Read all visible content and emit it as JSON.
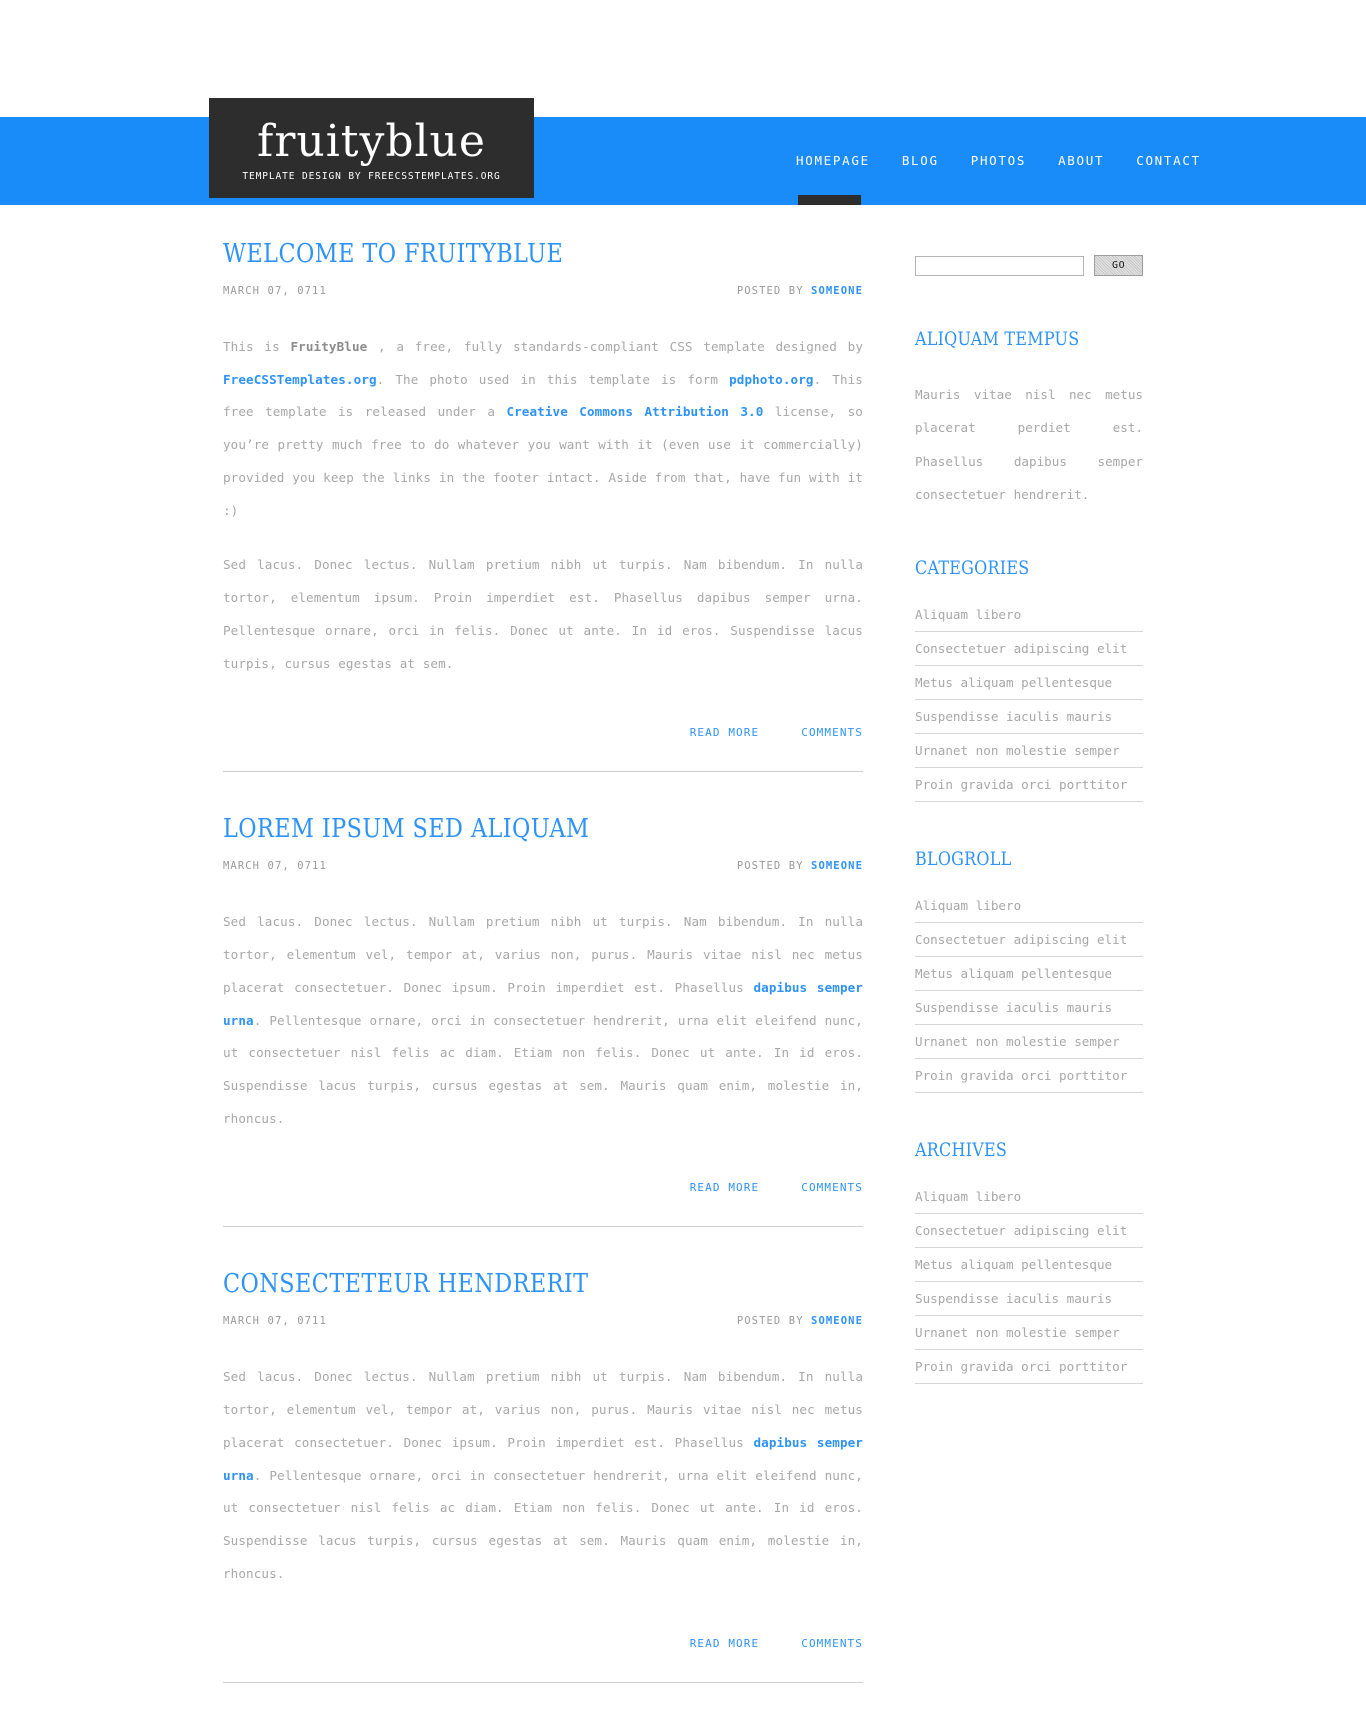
{
  "site": {
    "logo_title": "fruityblue",
    "logo_subtitle": "TEMPLATE DESIGN BY FREECSSTEMPLATES.ORG",
    "accent_blue": "#1a8cfa",
    "link_blue": "#2e93f7",
    "dark": "#2d2d2d"
  },
  "nav": {
    "items": [
      {
        "label": "HOMEPAGE",
        "active": true
      },
      {
        "label": "BLOG",
        "active": false
      },
      {
        "label": "PHOTOS",
        "active": false
      },
      {
        "label": "ABOUT",
        "active": false
      },
      {
        "label": "CONTACT",
        "active": false
      }
    ]
  },
  "posts": [
    {
      "title": "WELCOME TO FRUITYBLUE",
      "date": "MARCH 07, 0711",
      "posted_by_label": "POSTED BY",
      "author": "SOMEONE",
      "paragraph1_parts": [
        {
          "text": "This is ",
          "style": "normal"
        },
        {
          "text": "FruityBlue",
          "style": "bold"
        },
        {
          "text": " , a free, fully standards-compliant CSS template designed by ",
          "style": "normal"
        },
        {
          "text": "FreeCSSTemplates.org",
          "style": "link"
        },
        {
          "text": ". The photo used in this template is form ",
          "style": "normal"
        },
        {
          "text": "pdphoto.org",
          "style": "link"
        },
        {
          "text": ". This free template is released under a ",
          "style": "normal"
        },
        {
          "text": "Creative Commons Attribution 3.0",
          "style": "link"
        },
        {
          "text": " license, so you’re pretty much free to do whatever you want with it (even use it commercially) provided you keep the links in the footer intact. Aside from that, have fun with it :)",
          "style": "normal"
        }
      ],
      "paragraph2_parts": [
        {
          "text": "Sed lacus. Donec lectus. Nullam pretium nibh ut turpis. Nam bibendum. In nulla tortor, elementum ipsum. Proin imperdiet est. Phasellus dapibus semper urna. Pellentesque ornare, orci in felis. Donec ut ante. In id eros. Suspendisse lacus turpis, cursus egestas at sem.",
          "style": "normal"
        }
      ],
      "read_more": "READ MORE",
      "comments": "COMMENTS"
    },
    {
      "title": "LOREM IPSUM SED ALIQUAM",
      "date": "MARCH 07, 0711",
      "posted_by_label": "POSTED BY",
      "author": "SOMEONE",
      "paragraph1_parts": [
        {
          "text": "Sed lacus. Donec lectus. Nullam pretium nibh ut turpis. Nam bibendum. In nulla tortor, elementum vel, tempor at, varius non, purus. Mauris vitae nisl nec metus placerat consectetuer. Donec ipsum. Proin imperdiet est. Phasellus ",
          "style": "normal"
        },
        {
          "text": "dapibus semper urna",
          "style": "link"
        },
        {
          "text": ". Pellentesque ornare, orci in consectetuer hendrerit, urna elit eleifend nunc, ut consectetuer nisl felis ac diam. Etiam non felis. Donec ut ante. In id eros. Suspendisse lacus turpis, cursus egestas at sem. Mauris quam enim, molestie in, rhoncus.",
          "style": "normal"
        }
      ],
      "read_more": "READ MORE",
      "comments": "COMMENTS"
    },
    {
      "title": "CONSECTETEUR HENDRERIT",
      "date": "MARCH 07, 0711",
      "posted_by_label": "POSTED BY",
      "author": "SOMEONE",
      "paragraph1_parts": [
        {
          "text": "Sed lacus. Donec lectus. Nullam pretium nibh ut turpis. Nam bibendum. In nulla tortor, elementum vel, tempor at, varius non, purus. Mauris vitae nisl nec metus placerat consectetuer. Donec ipsum. Proin imperdiet est. Phasellus ",
          "style": "normal"
        },
        {
          "text": "dapibus semper urna",
          "style": "link"
        },
        {
          "text": ". Pellentesque ornare, orci in consectetuer hendrerit, urna elit eleifend nunc, ut consectetuer nisl felis ac diam. Etiam non felis. Donec ut ante. In id eros. Suspendisse lacus turpis, cursus egestas at sem. Mauris quam enim, molestie in, rhoncus.",
          "style": "normal"
        }
      ],
      "read_more": "READ MORE",
      "comments": "COMMENTS"
    }
  ],
  "sidebar": {
    "search": {
      "value": "",
      "placeholder": "",
      "button_label": "GO"
    },
    "blocks": [
      {
        "heading": "ALIQUAM TEMPUS",
        "type": "text",
        "text": "Mauris vitae nisl nec metus placerat perdiet est. Phasellus dapibus semper consectetuer hendrerit."
      },
      {
        "heading": "CATEGORIES",
        "type": "list",
        "items": [
          "Aliquam libero",
          "Consectetuer adipiscing elit",
          "Metus aliquam pellentesque",
          "Suspendisse iaculis mauris",
          "Urnanet non molestie semper",
          "Proin gravida orci porttitor"
        ]
      },
      {
        "heading": "BLOGROLL",
        "type": "list",
        "items": [
          "Aliquam libero",
          "Consectetuer adipiscing elit",
          "Metus aliquam pellentesque",
          "Suspendisse iaculis mauris",
          "Urnanet non molestie semper",
          "Proin gravida orci porttitor"
        ]
      },
      {
        "heading": "ARCHIVES",
        "type": "list",
        "items": [
          "Aliquam libero",
          "Consectetuer adipiscing elit",
          "Metus aliquam pellentesque",
          "Suspendisse iaculis mauris",
          "Urnanet non molestie semper",
          "Proin gravida orci porttitor"
        ]
      }
    ]
  }
}
